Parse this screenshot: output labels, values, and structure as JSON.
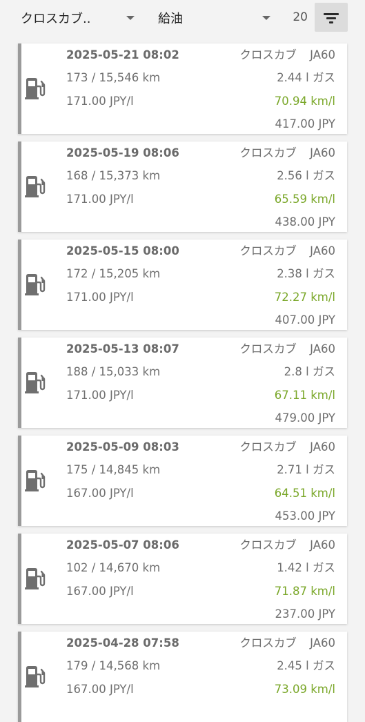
{
  "filters": {
    "vehicle": "クロスカブ..",
    "type": "給油",
    "count": "20"
  },
  "icons": {
    "entry": "fuel-pump-icon",
    "filter": "filter-list-icon",
    "dropdown": "caret-down-icon"
  },
  "colors": {
    "accent_bar": "#9a9a9a",
    "efficiency": "#7aa729",
    "text": "#6f6f6f"
  },
  "entries": [
    {
      "date": "2025-05-21 08:02",
      "vehicle": "クロスカブ JA60",
      "odometer": "173 / 15,546 km",
      "volume": "2.44 l ガス",
      "unit_price": "171.00 JPY/l",
      "efficiency": "70.94 km/l",
      "cost": "417.00 JPY"
    },
    {
      "date": "2025-05-19 08:06",
      "vehicle": "クロスカブ JA60",
      "odometer": "168 / 15,373 km",
      "volume": "2.56 l ガス",
      "unit_price": "171.00 JPY/l",
      "efficiency": "65.59 km/l",
      "cost": "438.00 JPY"
    },
    {
      "date": "2025-05-15 08:00",
      "vehicle": "クロスカブ JA60",
      "odometer": "172 / 15,205 km",
      "volume": "2.38 l ガス",
      "unit_price": "171.00 JPY/l",
      "efficiency": "72.27 km/l",
      "cost": "407.00 JPY"
    },
    {
      "date": "2025-05-13 08:07",
      "vehicle": "クロスカブ JA60",
      "odometer": "188 / 15,033 km",
      "volume": "2.8 l ガス",
      "unit_price": "171.00 JPY/l",
      "efficiency": "67.11 km/l",
      "cost": "479.00 JPY"
    },
    {
      "date": "2025-05-09 08:03",
      "vehicle": "クロスカブ JA60",
      "odometer": "175 / 14,845 km",
      "volume": "2.71 l ガス",
      "unit_price": "167.00 JPY/l",
      "efficiency": "64.51 km/l",
      "cost": "453.00 JPY"
    },
    {
      "date": "2025-05-07 08:06",
      "vehicle": "クロスカブ JA60",
      "odometer": "102 / 14,670 km",
      "volume": "1.42 l ガス",
      "unit_price": "167.00 JPY/l",
      "efficiency": "71.87 km/l",
      "cost": "237.00 JPY"
    },
    {
      "date": "2025-04-28 07:58",
      "vehicle": "クロスカブ JA60",
      "odometer": "179 / 14,568 km",
      "volume": "2.45 l ガス",
      "unit_price": "167.00 JPY/l",
      "efficiency": "73.09 km/l",
      "cost": ""
    }
  ]
}
